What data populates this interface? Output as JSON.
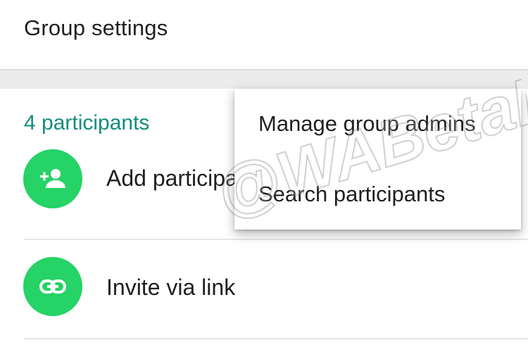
{
  "settings": {
    "group_settings_label": "Group settings"
  },
  "participants": {
    "count_label": "4 participants",
    "add_label": "Add participants",
    "add_icon": "person-add-icon",
    "invite_label": "Invite via link",
    "invite_icon": "link-icon"
  },
  "overflow_menu": {
    "items": [
      {
        "label": "Manage group admins"
      },
      {
        "label": "Search participants"
      }
    ]
  },
  "watermark": {
    "text": "@WABetaInfo"
  },
  "colors": {
    "accent_teal": "#128c7e",
    "icon_green": "#25d366",
    "text": "#1f1f1f",
    "divider": "#ececec"
  }
}
